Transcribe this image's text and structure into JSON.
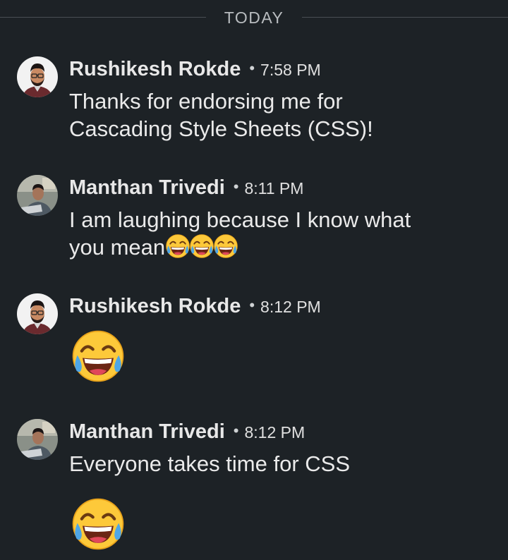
{
  "divider": {
    "label": "TODAY"
  },
  "messages": [
    {
      "sender": "Rushikesh Rokde",
      "separator": "•",
      "time": "7:58 PM",
      "text_lines": [
        "Thanks for endorsing me for",
        "Cascading Style Sheets (CSS)!"
      ]
    },
    {
      "sender": "Manthan Trivedi",
      "separator": "•",
      "time": "8:11 PM",
      "text_lines": [
        "I am laughing because I know what",
        "you mean"
      ],
      "inline_emoji": [
        "face-with-tears-of-joy",
        "face-with-tears-of-joy",
        "face-with-tears-of-joy"
      ]
    },
    {
      "sender": "Rushikesh Rokde",
      "separator": "•",
      "time": "8:12 PM",
      "emoji": "face-with-tears-of-joy"
    },
    {
      "sender": "Manthan Trivedi",
      "separator": "•",
      "time": "8:12 PM",
      "text_lines": [
        "Everyone takes time for CSS"
      ],
      "emoji": "face-with-tears-of-joy"
    }
  ],
  "colors": {
    "background": "#1d2226",
    "text": "#eaeaea",
    "divider_line": "#4a4f54",
    "emoji_yellow": "#fdc93a"
  }
}
